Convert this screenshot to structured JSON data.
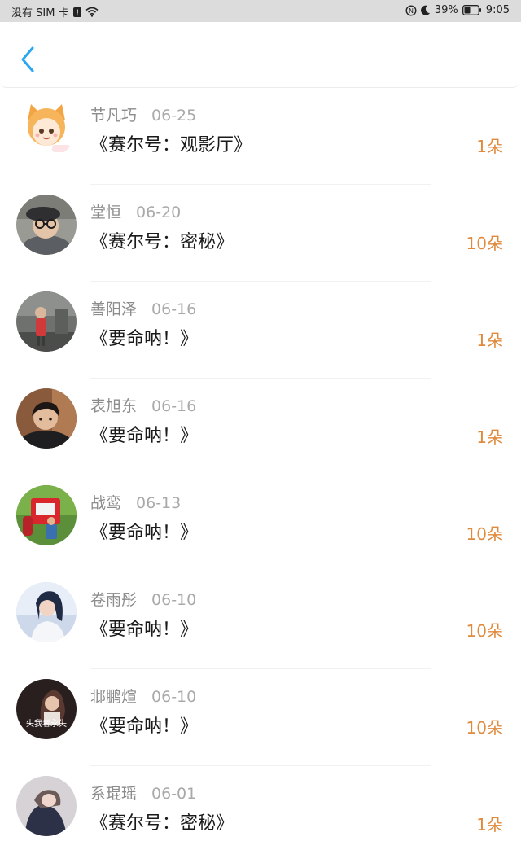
{
  "status_bar": {
    "carrier": "没有 SIM 卡",
    "battery": "39%",
    "time": "9:05"
  },
  "header": {
    "back_icon": "chevron-left-icon"
  },
  "colors": {
    "accent": "#2aa7f0",
    "count": "#e08a3c"
  },
  "items": [
    {
      "name": "节凡巧",
      "date": "06-25",
      "title": "《赛尔号：观影厅》",
      "count": "1朵"
    },
    {
      "name": "堂恒",
      "date": "06-20",
      "title": "《赛尔号：密秘》",
      "count": "10朵"
    },
    {
      "name": "善阳泽",
      "date": "06-16",
      "title": "《要命呐！》",
      "count": "1朵"
    },
    {
      "name": "表旭东",
      "date": "06-16",
      "title": "《要命呐！》",
      "count": "1朵"
    },
    {
      "name": "战鸾",
      "date": "06-13",
      "title": "《要命呐！》",
      "count": "10朵"
    },
    {
      "name": "卷雨彤",
      "date": "06-10",
      "title": "《要命呐！》",
      "count": "10朵"
    },
    {
      "name": "邶鹏煊",
      "date": "06-10",
      "title": "《要命呐！》",
      "count": "10朵"
    },
    {
      "name": "系琨瑶",
      "date": "06-01",
      "title": "《赛尔号：密秘》",
      "count": "1朵"
    }
  ],
  "avatar_captions": {
    "item7": "失我者永失"
  }
}
